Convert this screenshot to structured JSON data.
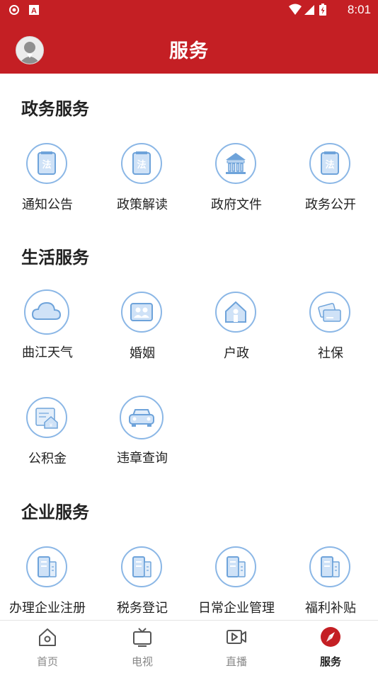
{
  "status_bar": {
    "time": "8:01",
    "left_icons": [
      "app-notification-icon",
      "text-notification-icon"
    ],
    "right_icons": [
      "wifi-icon",
      "signal-icon",
      "battery-icon"
    ]
  },
  "header": {
    "title": "服务",
    "avatar_icon": "user-avatar-icon"
  },
  "sections": [
    {
      "title": "政务服务",
      "items": [
        {
          "label": "通知公告",
          "icon": "law-book-icon"
        },
        {
          "label": "政策解读",
          "icon": "law-book-icon"
        },
        {
          "label": "政府文件",
          "icon": "government-building-icon"
        },
        {
          "label": "政务公开",
          "icon": "law-book-icon"
        }
      ]
    },
    {
      "title": "生活服务",
      "items": [
        {
          "label": "曲江天气",
          "icon": "cloud-icon"
        },
        {
          "label": "婚姻",
          "icon": "couple-icon"
        },
        {
          "label": "户政",
          "icon": "house-person-icon"
        },
        {
          "label": "社保",
          "icon": "cards-icon"
        },
        {
          "label": "公积金",
          "icon": "housing-fund-icon"
        },
        {
          "label": "违章查询",
          "icon": "car-icon"
        }
      ]
    },
    {
      "title": "企业服务",
      "items": [
        {
          "label": "办理企业注册",
          "icon": "office-building-icon"
        },
        {
          "label": "税务登记",
          "icon": "office-building-icon"
        },
        {
          "label": "日常企业管理",
          "icon": "office-building-icon"
        },
        {
          "label": "福利补贴",
          "icon": "office-building-icon"
        }
      ]
    }
  ],
  "bottom_nav": {
    "items": [
      {
        "label": "首页",
        "icon": "home-icon",
        "active": false
      },
      {
        "label": "电视",
        "icon": "tv-icon",
        "active": false
      },
      {
        "label": "直播",
        "icon": "live-video-icon",
        "active": false
      },
      {
        "label": "服务",
        "icon": "compass-icon",
        "active": true
      }
    ]
  },
  "colors": {
    "brand_red": "#c41f24",
    "icon_blue": "#8bb7e6",
    "icon_fill": "#cfe2f7",
    "text_dark": "#222222",
    "nav_inactive": "#888888"
  }
}
